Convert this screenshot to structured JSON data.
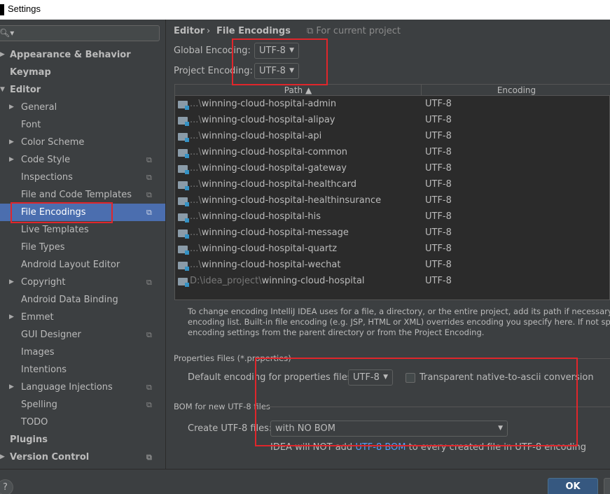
{
  "window": {
    "title": "Settings"
  },
  "sidebar": {
    "items": [
      {
        "label": "Appearance & Behavior"
      },
      {
        "label": "Keymap"
      },
      {
        "label": "Editor"
      },
      {
        "label": "General"
      },
      {
        "label": "Font"
      },
      {
        "label": "Color Scheme"
      },
      {
        "label": "Code Style"
      },
      {
        "label": "Inspections"
      },
      {
        "label": "File and Code Templates"
      },
      {
        "label": "File Encodings"
      },
      {
        "label": "Live Templates"
      },
      {
        "label": "File Types"
      },
      {
        "label": "Android Layout Editor"
      },
      {
        "label": "Copyright"
      },
      {
        "label": "Android Data Binding"
      },
      {
        "label": "Emmet"
      },
      {
        "label": "GUI Designer"
      },
      {
        "label": "Images"
      },
      {
        "label": "Intentions"
      },
      {
        "label": "Language Injections"
      },
      {
        "label": "Spelling"
      },
      {
        "label": "TODO"
      },
      {
        "label": "Plugins"
      },
      {
        "label": "Version Control"
      }
    ]
  },
  "header": {
    "breadcrumb_parent": "Editor",
    "breadcrumb_sep": "›",
    "breadcrumb_current": "File Encodings",
    "scope": "For current project"
  },
  "encodings": {
    "global_label": "Global Encoding:",
    "global_value": "UTF-8",
    "project_label": "Project Encoding:",
    "project_value": "UTF-8"
  },
  "table": {
    "col_path": "Path",
    "col_encoding": "Encoding",
    "rows": [
      {
        "prefix": "...\\",
        "path": "winning-cloud-hospital-admin",
        "encoding": "UTF-8"
      },
      {
        "prefix": "...\\",
        "path": "winning-cloud-hospital-alipay",
        "encoding": "UTF-8"
      },
      {
        "prefix": "...\\",
        "path": "winning-cloud-hospital-api",
        "encoding": "UTF-8"
      },
      {
        "prefix": "...\\",
        "path": "winning-cloud-hospital-common",
        "encoding": "UTF-8"
      },
      {
        "prefix": "...\\",
        "path": "winning-cloud-hospital-gateway",
        "encoding": "UTF-8"
      },
      {
        "prefix": "...\\",
        "path": "winning-cloud-hospital-healthcard",
        "encoding": "UTF-8"
      },
      {
        "prefix": "...\\",
        "path": "winning-cloud-hospital-healthinsurance",
        "encoding": "UTF-8"
      },
      {
        "prefix": "...\\",
        "path": "winning-cloud-hospital-his",
        "encoding": "UTF-8"
      },
      {
        "prefix": "...\\",
        "path": "winning-cloud-hospital-message",
        "encoding": "UTF-8"
      },
      {
        "prefix": "...\\",
        "path": "winning-cloud-hospital-quartz",
        "encoding": "UTF-8"
      },
      {
        "prefix": "...\\",
        "path": "winning-cloud-hospital-wechat",
        "encoding": "UTF-8"
      },
      {
        "prefix": "D:\\idea_project\\",
        "path": "winning-cloud-hospital",
        "encoding": "UTF-8"
      }
    ]
  },
  "help_text": {
    "line1": "To change encoding IntelliJ IDEA uses for a file, a directory, or the entire project, add its path if necessary and then s",
    "line2": "encoding list. Built-in file encoding (e.g. JSP, HTML or XML) overrides encoding you specify here. If not specified, fi",
    "line3": "encoding settings from the parent directory or from the Project Encoding."
  },
  "properties": {
    "section_title": "Properties Files (*.properties)",
    "default_label": "Default encoding for properties files:",
    "default_value": "UTF-8",
    "native_label": "Transparent native-to-ascii conversion"
  },
  "bom": {
    "section_title": "BOM for new UTF-8 files",
    "create_label": "Create UTF-8 files:",
    "create_value": "with NO BOM",
    "note_pre": "IDEA will NOT add ",
    "note_link": "UTF-8 BOM",
    "note_post": " to every created file in UTF-8 encoding"
  },
  "footer": {
    "help": "?",
    "ok": "OK"
  },
  "colors": {
    "selection": "#4b6eaf",
    "highlight": "#e0262b",
    "link": "#589df6"
  }
}
